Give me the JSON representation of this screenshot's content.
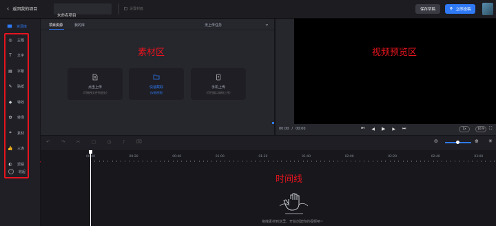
{
  "header": {
    "back_label": "返回我的项目",
    "project_name": "未命名项目",
    "save_hint": "设置封面",
    "save_draft": "保存草稿",
    "export": "立即投稿"
  },
  "sidebar": {
    "active": "资源库",
    "items": [
      {
        "label": "主题",
        "icon": "theme-icon"
      },
      {
        "label": "文字",
        "icon": "text-icon"
      },
      {
        "label": "字幕",
        "icon": "subtitle-icon"
      },
      {
        "label": "贴纸",
        "icon": "sticker-icon"
      },
      {
        "label": "特效",
        "icon": "effect-icon"
      },
      {
        "label": "转场",
        "icon": "transition-icon"
      },
      {
        "label": "素材",
        "icon": "crop-icon"
      },
      {
        "label": "三连",
        "icon": "thumb-icon"
      },
      {
        "label": "滤镜",
        "icon": "filter-icon"
      }
    ],
    "collapse": "收起"
  },
  "panel": {
    "tabs": [
      "项目资源",
      "我的库"
    ],
    "filter": "无上传任务",
    "overlay": "素材区",
    "cards": [
      {
        "title": "点击上传",
        "sub": "(可拖拽文件到此处)"
      },
      {
        "title": "快速截取",
        "sub": "(仅限视频)"
      },
      {
        "title": "手机上传",
        "sub": "(可扫描二维码上传)"
      }
    ]
  },
  "preview": {
    "overlay": "视频预览区",
    "time_current": "00:00",
    "time_sep": "/",
    "time_total": "00:00",
    "speed": "1x",
    "ratio": "16:9"
  },
  "timeline": {
    "overlay": "时间线",
    "ticks": [
      "00:00",
      "00:20",
      "00:40",
      "01:00",
      "01:20",
      "01:40",
      "02:00",
      "02:20",
      "02:40",
      "03:00"
    ],
    "empty_hint": "拖拽素材到这里，开始创建你的视频吧~"
  },
  "colors": {
    "accent": "#2f79f5",
    "annotation": "#e8141e"
  }
}
